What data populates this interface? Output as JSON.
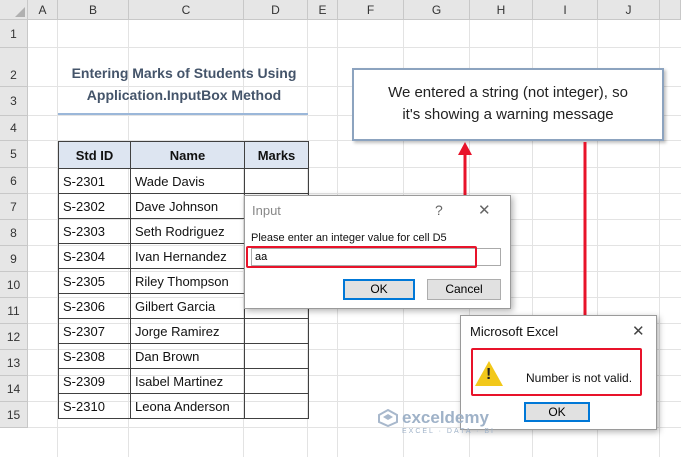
{
  "columns": [
    "A",
    "B",
    "C",
    "D",
    "E",
    "F",
    "G",
    "H",
    "I",
    "J"
  ],
  "rows": [
    "1",
    "2",
    "3",
    "4",
    "5",
    "6",
    "7",
    "8",
    "9",
    "10",
    "11",
    "12",
    "13",
    "14",
    "15"
  ],
  "title": {
    "line1": "Entering Marks of Students Using",
    "line2": "Application.InputBox Method"
  },
  "table": {
    "headers": [
      "Std ID",
      "Name",
      "Marks"
    ],
    "rows": [
      [
        "S-2301",
        "Wade Davis",
        ""
      ],
      [
        "S-2302",
        "Dave Johnson",
        ""
      ],
      [
        "S-2303",
        "Seth Rodriguez",
        ""
      ],
      [
        "S-2304",
        "Ivan Hernandez",
        ""
      ],
      [
        "S-2305",
        "Riley Thompson",
        ""
      ],
      [
        "S-2306",
        "Gilbert Garcia",
        ""
      ],
      [
        "S-2307",
        "Jorge Ramirez",
        ""
      ],
      [
        "S-2308",
        "Dan Brown",
        ""
      ],
      [
        "S-2309",
        "Isabel Martinez",
        ""
      ],
      [
        "S-2310",
        "Leona Anderson",
        ""
      ]
    ]
  },
  "callout": {
    "line1": "We entered a string (not integer), so",
    "line2": "it's showing a warning message"
  },
  "input_dialog": {
    "title": "Input",
    "help": "?",
    "close": "✕",
    "prompt": "Please enter an integer value for cell D5",
    "value": "aa",
    "ok_label": "OK",
    "cancel_label": "Cancel"
  },
  "error_dialog": {
    "title": "Microsoft Excel",
    "close": "✕",
    "message": "Number is not valid.",
    "ok_label": "OK"
  },
  "watermark": {
    "brand": "exceldemy",
    "tagline": "EXCEL · DATA · BI"
  },
  "colors": {
    "accent_red": "#e8132a",
    "title_blue": "#44546a",
    "header_fill": "#dde5f1"
  }
}
